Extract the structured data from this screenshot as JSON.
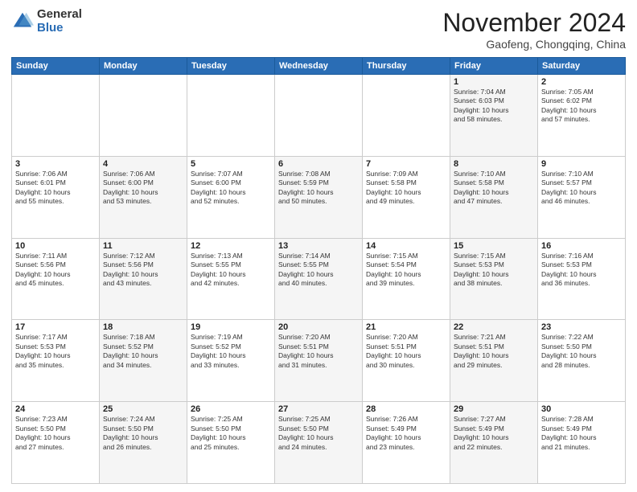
{
  "header": {
    "logo_general": "General",
    "logo_blue": "Blue",
    "month_title": "November 2024",
    "location": "Gaofeng, Chongqing, China"
  },
  "days_of_week": [
    "Sunday",
    "Monday",
    "Tuesday",
    "Wednesday",
    "Thursday",
    "Friday",
    "Saturday"
  ],
  "weeks": [
    [
      {
        "day": "",
        "info": ""
      },
      {
        "day": "",
        "info": ""
      },
      {
        "day": "",
        "info": ""
      },
      {
        "day": "",
        "info": ""
      },
      {
        "day": "",
        "info": ""
      },
      {
        "day": "1",
        "info": "Sunrise: 7:04 AM\nSunset: 6:03 PM\nDaylight: 10 hours\nand 58 minutes."
      },
      {
        "day": "2",
        "info": "Sunrise: 7:05 AM\nSunset: 6:02 PM\nDaylight: 10 hours\nand 57 minutes."
      }
    ],
    [
      {
        "day": "3",
        "info": "Sunrise: 7:06 AM\nSunset: 6:01 PM\nDaylight: 10 hours\nand 55 minutes."
      },
      {
        "day": "4",
        "info": "Sunrise: 7:06 AM\nSunset: 6:00 PM\nDaylight: 10 hours\nand 53 minutes."
      },
      {
        "day": "5",
        "info": "Sunrise: 7:07 AM\nSunset: 6:00 PM\nDaylight: 10 hours\nand 52 minutes."
      },
      {
        "day": "6",
        "info": "Sunrise: 7:08 AM\nSunset: 5:59 PM\nDaylight: 10 hours\nand 50 minutes."
      },
      {
        "day": "7",
        "info": "Sunrise: 7:09 AM\nSunset: 5:58 PM\nDaylight: 10 hours\nand 49 minutes."
      },
      {
        "day": "8",
        "info": "Sunrise: 7:10 AM\nSunset: 5:58 PM\nDaylight: 10 hours\nand 47 minutes."
      },
      {
        "day": "9",
        "info": "Sunrise: 7:10 AM\nSunset: 5:57 PM\nDaylight: 10 hours\nand 46 minutes."
      }
    ],
    [
      {
        "day": "10",
        "info": "Sunrise: 7:11 AM\nSunset: 5:56 PM\nDaylight: 10 hours\nand 45 minutes."
      },
      {
        "day": "11",
        "info": "Sunrise: 7:12 AM\nSunset: 5:56 PM\nDaylight: 10 hours\nand 43 minutes."
      },
      {
        "day": "12",
        "info": "Sunrise: 7:13 AM\nSunset: 5:55 PM\nDaylight: 10 hours\nand 42 minutes."
      },
      {
        "day": "13",
        "info": "Sunrise: 7:14 AM\nSunset: 5:55 PM\nDaylight: 10 hours\nand 40 minutes."
      },
      {
        "day": "14",
        "info": "Sunrise: 7:15 AM\nSunset: 5:54 PM\nDaylight: 10 hours\nand 39 minutes."
      },
      {
        "day": "15",
        "info": "Sunrise: 7:15 AM\nSunset: 5:53 PM\nDaylight: 10 hours\nand 38 minutes."
      },
      {
        "day": "16",
        "info": "Sunrise: 7:16 AM\nSunset: 5:53 PM\nDaylight: 10 hours\nand 36 minutes."
      }
    ],
    [
      {
        "day": "17",
        "info": "Sunrise: 7:17 AM\nSunset: 5:53 PM\nDaylight: 10 hours\nand 35 minutes."
      },
      {
        "day": "18",
        "info": "Sunrise: 7:18 AM\nSunset: 5:52 PM\nDaylight: 10 hours\nand 34 minutes."
      },
      {
        "day": "19",
        "info": "Sunrise: 7:19 AM\nSunset: 5:52 PM\nDaylight: 10 hours\nand 33 minutes."
      },
      {
        "day": "20",
        "info": "Sunrise: 7:20 AM\nSunset: 5:51 PM\nDaylight: 10 hours\nand 31 minutes."
      },
      {
        "day": "21",
        "info": "Sunrise: 7:20 AM\nSunset: 5:51 PM\nDaylight: 10 hours\nand 30 minutes."
      },
      {
        "day": "22",
        "info": "Sunrise: 7:21 AM\nSunset: 5:51 PM\nDaylight: 10 hours\nand 29 minutes."
      },
      {
        "day": "23",
        "info": "Sunrise: 7:22 AM\nSunset: 5:50 PM\nDaylight: 10 hours\nand 28 minutes."
      }
    ],
    [
      {
        "day": "24",
        "info": "Sunrise: 7:23 AM\nSunset: 5:50 PM\nDaylight: 10 hours\nand 27 minutes."
      },
      {
        "day": "25",
        "info": "Sunrise: 7:24 AM\nSunset: 5:50 PM\nDaylight: 10 hours\nand 26 minutes."
      },
      {
        "day": "26",
        "info": "Sunrise: 7:25 AM\nSunset: 5:50 PM\nDaylight: 10 hours\nand 25 minutes."
      },
      {
        "day": "27",
        "info": "Sunrise: 7:25 AM\nSunset: 5:50 PM\nDaylight: 10 hours\nand 24 minutes."
      },
      {
        "day": "28",
        "info": "Sunrise: 7:26 AM\nSunset: 5:49 PM\nDaylight: 10 hours\nand 23 minutes."
      },
      {
        "day": "29",
        "info": "Sunrise: 7:27 AM\nSunset: 5:49 PM\nDaylight: 10 hours\nand 22 minutes."
      },
      {
        "day": "30",
        "info": "Sunrise: 7:28 AM\nSunset: 5:49 PM\nDaylight: 10 hours\nand 21 minutes."
      }
    ]
  ]
}
